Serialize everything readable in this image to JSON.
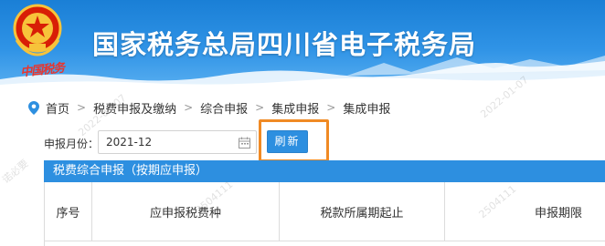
{
  "header": {
    "title": "国家税务总局四川省电子税务局",
    "emblem_script": "中国税务",
    "colors": {
      "banner_top": "#1a7fd6",
      "banner_bottom": "#58aef0"
    }
  },
  "breadcrumb": {
    "items": [
      "首页",
      "税费申报及缴纳",
      "综合申报",
      "集成申报",
      "集成申报"
    ]
  },
  "filter": {
    "month_label": "申报月份：",
    "month_value": "2021-12",
    "refresh_label": "刷新"
  },
  "section": {
    "title": "税费综合申报（按期应申报）"
  },
  "table": {
    "headers": [
      "序号",
      "应申报税费种",
      "税款所属期起止",
      "申报期限"
    ]
  },
  "watermark": {
    "texts": [
      "2022-01-07",
      "2504111",
      "2022-01-07",
      "2504111",
      "诺必要"
    ]
  },
  "colors": {
    "accent": "#2d8fe0",
    "highlight": "#f08a24"
  }
}
